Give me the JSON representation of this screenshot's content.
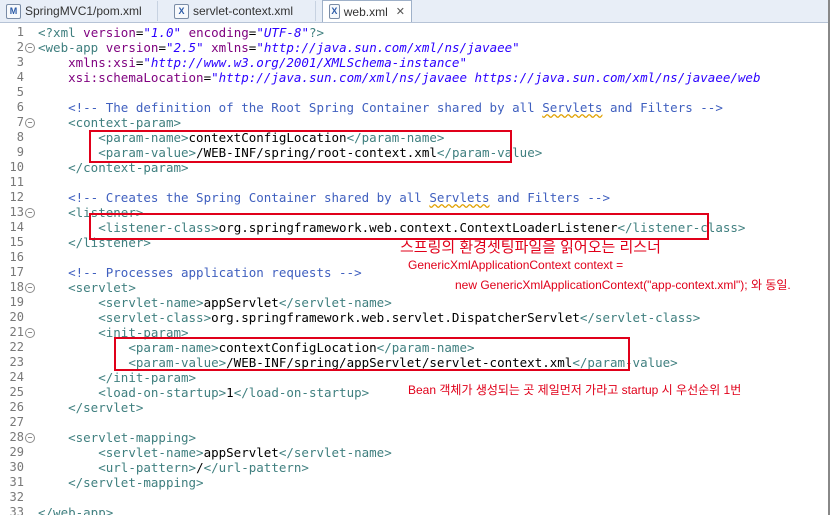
{
  "tabs": [
    {
      "label": "SpringMVC1/pom.xml",
      "icon": "M",
      "active": false
    },
    {
      "label": "servlet-context.xml",
      "icon": "X",
      "active": false
    },
    {
      "label": "web.xml",
      "icon": "X",
      "active": true
    }
  ],
  "close_glyph": "✕",
  "lines": [
    {
      "n": "1",
      "html": "<span class='tag'>&lt;?xml</span> <span class='attr'>version</span>=<span class='str'>\"1.0\"</span> <span class='attr'>encoding</span>=<span class='str'>\"UTF-8\"</span><span class='tag'>?&gt;</span>"
    },
    {
      "n": "2",
      "fold": true,
      "html": "<span class='tag'>&lt;web-app</span> <span class='attr'>version</span>=<span class='str'>\"2.5\"</span> <span class='attr'>xmlns</span>=<span class='str'>\"http://java.sun.com/xml/ns/javaee\"</span>"
    },
    {
      "n": "3",
      "html": "    <span class='attr'>xmlns:xsi</span>=<span class='str'>\"http://www.w3.org/2001/XMLSchema-instance\"</span>"
    },
    {
      "n": "4",
      "html": "    <span class='attr'>xsi:schemaLocation</span>=<span class='str'>\"http://java.sun.com/xml/ns/javaee https://java.sun.com/xml/ns/javaee/web</span>"
    },
    {
      "n": "5",
      "html": ""
    },
    {
      "n": "6",
      "html": "    <span class='cmt'>&lt;!-- The definition of the Root Spring Container shared by all <span class='sq'>Servlets</span> and Filters --&gt;</span>"
    },
    {
      "n": "7",
      "fold": true,
      "html": "    <span class='tag'>&lt;context-param&gt;</span>"
    },
    {
      "n": "8",
      "html": "        <span class='tag'>&lt;param-name&gt;</span>contextConfigLocation<span class='tag'>&lt;/param-name&gt;</span>"
    },
    {
      "n": "9",
      "html": "        <span class='tag'>&lt;param-value&gt;</span>/WEB-INF/spring/root-context.xml<span class='tag'>&lt;/param-value&gt;</span>"
    },
    {
      "n": "10",
      "html": "    <span class='tag'>&lt;/context-param&gt;</span>"
    },
    {
      "n": "11",
      "html": ""
    },
    {
      "n": "12",
      "html": "    <span class='cmt'>&lt;!-- Creates the Spring Container shared by all <span class='sq'>Servlets</span> and Filters --&gt;</span>"
    },
    {
      "n": "13",
      "fold": true,
      "html": "    <span class='tag'>&lt;listener&gt;</span>"
    },
    {
      "n": "14",
      "html": "        <span class='tag'>&lt;listener-class&gt;</span>org.springframework.web.context.ContextLoaderListener<span class='tag'>&lt;/listener-class&gt;</span>"
    },
    {
      "n": "15",
      "html": "    <span class='tag'>&lt;/listener&gt;</span>"
    },
    {
      "n": "16",
      "html": ""
    },
    {
      "n": "17",
      "html": "    <span class='cmt'>&lt;!-- Processes application requests --&gt;</span>"
    },
    {
      "n": "18",
      "fold": true,
      "html": "    <span class='tag'>&lt;servlet&gt;</span>"
    },
    {
      "n": "19",
      "html": "        <span class='tag'>&lt;servlet-name&gt;</span>appServlet<span class='tag'>&lt;/servlet-name&gt;</span>"
    },
    {
      "n": "20",
      "html": "        <span class='tag'>&lt;servlet-class&gt;</span>org.springframework.web.servlet.DispatcherServlet<span class='tag'>&lt;/servlet-class&gt;</span>"
    },
    {
      "n": "21",
      "fold": true,
      "html": "        <span class='tag'>&lt;init-param&gt;</span>"
    },
    {
      "n": "22",
      "html": "            <span class='tag'>&lt;param-name&gt;</span>contextConfigLocation<span class='tag'>&lt;/param-name&gt;</span>"
    },
    {
      "n": "23",
      "html": "            <span class='tag'>&lt;param-value&gt;</span>/WEB-INF/spring/appServlet/servlet-context.xml<span class='tag'>&lt;/param-value&gt;</span>"
    },
    {
      "n": "24",
      "html": "        <span class='tag'>&lt;/init-param&gt;</span>"
    },
    {
      "n": "25",
      "html": "        <span class='tag'>&lt;load-on-startup&gt;</span>1<span class='tag'>&lt;/load-on-startup&gt;</span>"
    },
    {
      "n": "26",
      "html": "    <span class='tag'>&lt;/servlet&gt;</span>"
    },
    {
      "n": "27",
      "html": ""
    },
    {
      "n": "28",
      "fold": true,
      "html": "    <span class='tag'>&lt;servlet-mapping&gt;</span>"
    },
    {
      "n": "29",
      "html": "        <span class='tag'>&lt;servlet-name&gt;</span>appServlet<span class='tag'>&lt;/servlet-name&gt;</span>"
    },
    {
      "n": "30",
      "html": "        <span class='tag'>&lt;url-pattern&gt;</span>/<span class='tag'>&lt;/url-pattern&gt;</span>"
    },
    {
      "n": "31",
      "html": "    <span class='tag'>&lt;/servlet-mapping&gt;</span>"
    },
    {
      "n": "32",
      "html": ""
    },
    {
      "n": "33",
      "html": "<span class='tag'>&lt;/web-app&gt;</span>"
    }
  ],
  "annotations": {
    "listener_note": "스프링의 환경셋팅파일을 읽어오는 리스너",
    "context_line1": "GenericXmlApplicationContext context =",
    "context_line2": "new GenericXmlApplicationContext(\"app-context.xml\"); 와 동일.",
    "bean_note": "Bean 객체가 생성되는 곳 제일먼저 가라고 startup 시 우선순위 1번"
  },
  "colors": {
    "annotation": "#e0001a",
    "tag": "#3f7f7f",
    "attr": "#7f007f",
    "string": "#2a00ff",
    "comment": "#3f5fbf"
  }
}
